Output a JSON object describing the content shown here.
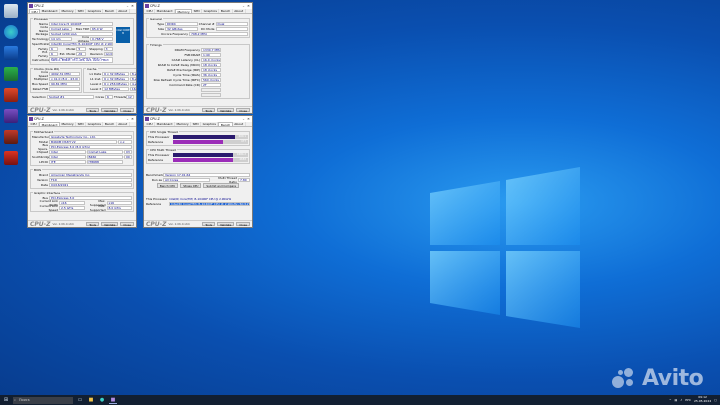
{
  "windows": {
    "cpu": {
      "title": "CPU-Z",
      "tabs": [
        "CPU",
        "Mainboard",
        "Memory",
        "SPD",
        "Graphics",
        "Bench",
        "About"
      ],
      "processor_group": "Processor",
      "name_label": "Name",
      "name": "Intel Core i5 10400F",
      "codename_label": "Code Name",
      "codename": "Comet Lake",
      "maxtdp_label": "Max TDP",
      "maxtdp": "65.0 W",
      "package_label": "Package",
      "package": "Socket 1200 LGA",
      "technology_label": "Technology",
      "technology": "14 nm",
      "voltage_label": "Core Voltage",
      "voltage": "0.768 V",
      "spec_label": "Specification",
      "spec": "Intel(R) Core(TM) i5-10400F CPU @ 2.90GHz",
      "family_label": "Family",
      "family": "6",
      "model_label": "Model",
      "model": "5",
      "stepping_label": "Stepping",
      "stepping": "3",
      "extfamily_label": "Ext. Family",
      "extfamily": "6",
      "extmodel_label": "Ext. Model",
      "extmodel": "A5",
      "revision_label": "Revision",
      "revision": "G1/Q0",
      "instr_label": "Instructions",
      "instr": "MMX, SSE, SSE2, SSE3, SSSE3, SSE4.1, SSE4.2, EM64T, VT-x, AES, AVX, AVX2, FMA3",
      "clocks_group": "Clocks (Core #0)",
      "cache_group": "Cache",
      "corespeed_label": "Core Speed",
      "corespeed": "4092.31 MHz",
      "multiplier_label": "Multiplier",
      "multiplier": "x 41.0 (8.0 - 43.0)",
      "busspeed_label": "Bus Speed",
      "busspeed": "99.81 MHz",
      "ratedfsb_label": "Rated FSB",
      "ratedfsb": "",
      "l1d_label": "L1 Data",
      "l1d": "6 x 32 KBytes",
      "l1d_way": "8-way",
      "l1i_label": "L1 Inst.",
      "l1i": "6 x 32 KBytes",
      "l1i_way": "8-way",
      "l2_label": "Level 2",
      "l2": "6 x 256 KBytes",
      "l2_way": "4-way",
      "l3_label": "Level 3",
      "l3": "12 MBytes",
      "l3_way": "16-way",
      "selection_label": "Selection",
      "selection": "Socket #1",
      "cores_label": "Cores",
      "cores": "6",
      "threads_label": "Threads",
      "threads": "12",
      "version": "Ver. 2.06.0.x64",
      "tools": "Tools",
      "validate": "Validate",
      "close": "Close",
      "intel_badge": "intel CORE i5"
    },
    "memory": {
      "title": "CPU-Z",
      "tabs": [
        "CPU",
        "Mainboard",
        "Memory",
        "SPD",
        "Graphics",
        "Bench",
        "About"
      ],
      "general_group": "General",
      "type_label": "Type",
      "type": "DDR4",
      "channel_label": "Channel #",
      "channel": "Dual",
      "size_label": "Size",
      "size": "32 GBytes",
      "dcmode_label": "DC Mode",
      "dcmode": "",
      "uncore_label": "Uncore Frequency",
      "uncore": "798.2 MHz",
      "timings_group": "Timings",
      "dram_label": "DRAM Frequency",
      "dram": "1330.7 MHz",
      "fsbdram_label": "FSB:DRAM",
      "fsbdram": "1:40",
      "cl_label": "CAS# Latency (CL)",
      "cl": "16.0 clocks",
      "trcd_label": "RAS# to CAS# Delay (tRCD)",
      "trcd": "18 clocks",
      "trp_label": "RAS# Precharge (tRP)",
      "trp": "18 clocks",
      "tras_label": "Cycle Time (tRAS)",
      "tras": "36 clocks",
      "trfc_label": "Row Refresh Cycle Time (tRFC)",
      "trfc": "560 clocks",
      "cr_label": "Command Rate (CR)",
      "cr": "2T",
      "version": "Ver. 2.06.0.x64",
      "tools": "Tools",
      "validate": "Validate",
      "close": "Close"
    },
    "mainboard": {
      "title": "CPU-Z",
      "tabs": [
        "CPU",
        "Mainboard",
        "Memory",
        "SPD",
        "Graphics",
        "Bench",
        "About"
      ],
      "mb_group": "Motherboard",
      "manu_label": "Manufacturer",
      "manu": "Gigabyte Technology Co., Ltd.",
      "model_label": "Model",
      "model": "B460M DS3H V2",
      "model_rev": "x.x",
      "bus_label": "Bus Specs.",
      "bus": "PCI-Express 3.0 (8.0 GT/s)",
      "chipset_label": "Chipset",
      "chipset": "Intel",
      "chipset_name": "Comet Lake",
      "chipset_rev": "03",
      "sb_label": "Southbridge",
      "sb": "Intel",
      "sb_name": "B460",
      "sb_rev": "00",
      "lpcio_label": "LPCIO",
      "lpcio": "ITE",
      "lpcio_name": "IT8688",
      "bios_group": "BIOS",
      "brand_label": "Brand",
      "brand": "American Megatrends Inc.",
      "bver_label": "Version",
      "bver": "F1D",
      "date_label": "Date",
      "date": "04/16/2021",
      "gi_group": "Graphic Interface",
      "gbus_label": "Bus",
      "gbus": "PCI-Express 3.0",
      "clw_label": "Current Link Width",
      "clw": "x16",
      "mls_label": "Max. Supported",
      "mls": "x16",
      "cls_label": "Current Link Speed",
      "cls": "2.5 GT/s",
      "mss_label": "Max. Supported",
      "mss": "8.0 GT/s",
      "version": "Ver. 2.06.0.x64",
      "tools": "Tools",
      "validate": "Validate",
      "close": "Close"
    },
    "bench": {
      "title": "CPU-Z",
      "tabs": [
        "CPU",
        "Mainboard",
        "Memory",
        "SPD",
        "Graphics",
        "Bench",
        "About"
      ],
      "single_group": "CPU Single Thread",
      "this_label": "This Processor",
      "single_this": "600.1",
      "single_this_frac": 0.83,
      "ref_label": "Reference",
      "single_ref": "477",
      "single_ref_frac": 0.66,
      "multi_group": "CPU Multi Thread",
      "multi_this": "4684.2",
      "multi_this_frac": 0.8,
      "multi_ref": "4683",
      "multi_ref_frac": 0.8,
      "benchmark_label": "Benchmark",
      "benchmark": "Version 17.01.64",
      "runas_label": "Run as",
      "runas": "All Cores",
      "ratio_label": "Multi Thread Ratio",
      "ratio": "7.80",
      "bench_btn": "Bench CPU",
      "stress_btn": "Stress CPU",
      "submit_btn": "Submit and Compare",
      "proc_title": "This Processor",
      "proc_name": "Intel(R) Core(TM) i5-10400F CPU @ 2.90GHz",
      "ref_combo_label": "Reference",
      "ref_combo": "Intel(R) Core(TM) i5-10400F CPU @ 2.90GHz (6C/12T)",
      "version": "Ver. 2.06.0.x64",
      "tools": "Tools",
      "validate": "Validate",
      "close": "Close",
      "bar_this_color": "#2a1a6e",
      "bar_ref_color": "#9b2db8"
    }
  },
  "taskbar": {
    "search_placeholder": "Поиск",
    "tray_lang": "РУС",
    "time": "09:12",
    "date": "25.05.2024"
  },
  "watermark": "Avito"
}
